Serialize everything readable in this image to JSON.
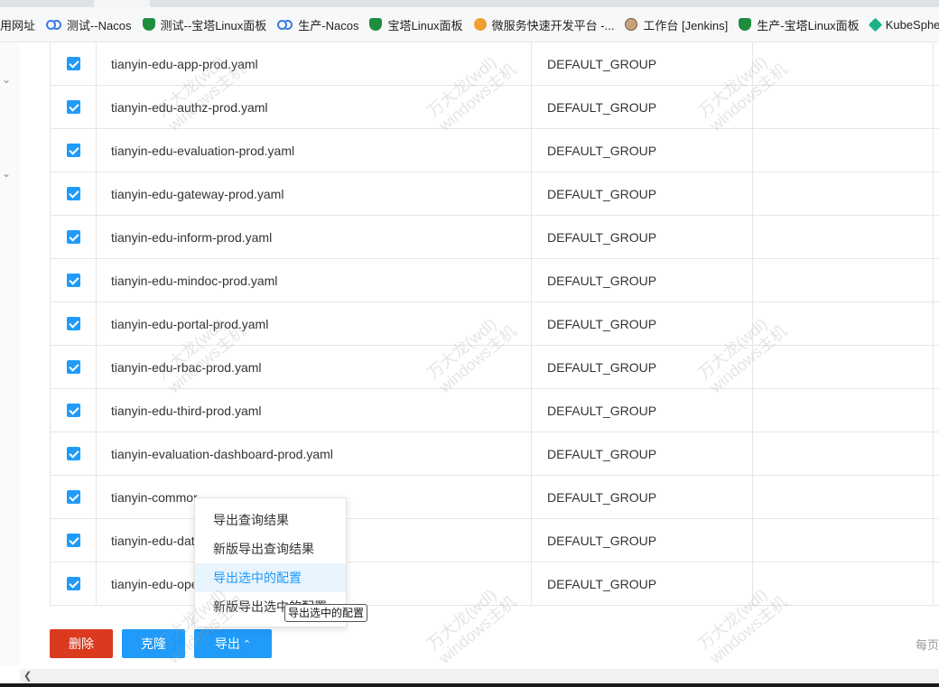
{
  "bookmarks": [
    {
      "label": "用网址",
      "icon": "none"
    },
    {
      "label": "测试--Nacos",
      "icon": "infinity-icon"
    },
    {
      "label": "测试--宝塔Linux面板",
      "icon": "shield-icon"
    },
    {
      "label": "生产-Nacos",
      "icon": "infinity-icon"
    },
    {
      "label": "宝塔Linux面板",
      "icon": "shield-icon"
    },
    {
      "label": "微服务快速开发平台 -...",
      "icon": "app-icon"
    },
    {
      "label": "工作台 [Jenkins]",
      "icon": "jenkins-icon"
    },
    {
      "label": "生产-宝塔Linux面板",
      "icon": "shield-icon"
    },
    {
      "label": "KubeSphere",
      "icon": "kubesphere-icon"
    }
  ],
  "rows": [
    {
      "data_id": "tianyin-edu-app-prod.yaml",
      "group": "DEFAULT_GROUP"
    },
    {
      "data_id": "tianyin-edu-authz-prod.yaml",
      "group": "DEFAULT_GROUP"
    },
    {
      "data_id": "tianyin-edu-evaluation-prod.yaml",
      "group": "DEFAULT_GROUP"
    },
    {
      "data_id": "tianyin-edu-gateway-prod.yaml",
      "group": "DEFAULT_GROUP"
    },
    {
      "data_id": "tianyin-edu-inform-prod.yaml",
      "group": "DEFAULT_GROUP"
    },
    {
      "data_id": "tianyin-edu-mindoc-prod.yaml",
      "group": "DEFAULT_GROUP"
    },
    {
      "data_id": "tianyin-edu-portal-prod.yaml",
      "group": "DEFAULT_GROUP"
    },
    {
      "data_id": "tianyin-edu-rbac-prod.yaml",
      "group": "DEFAULT_GROUP"
    },
    {
      "data_id": "tianyin-edu-third-prod.yaml",
      "group": "DEFAULT_GROUP"
    },
    {
      "data_id": "tianyin-evaluation-dashboard-prod.yaml",
      "group": "DEFAULT_GROUP"
    },
    {
      "data_id": "tianyin-commor",
      "group": "DEFAULT_GROUP"
    },
    {
      "data_id": "tianyin-edu-data",
      "group": "DEFAULT_GROUP"
    },
    {
      "data_id": "tianyin-edu-ope",
      "group": "DEFAULT_GROUP"
    }
  ],
  "buttons": {
    "delete": "删除",
    "clone": "克隆",
    "export": "导出",
    "export_caret": "⌃"
  },
  "export_menu": {
    "items": [
      "导出查询结果",
      "新版导出查询结果",
      "导出选中的配置",
      "新版导出选中的配置"
    ],
    "active_index": 2
  },
  "tooltip": "导出选中的配置",
  "pagination": {
    "prefix": "每页"
  },
  "watermark": {
    "line1": "万大龙(wdl)",
    "line2": "windows主机"
  },
  "colors": {
    "primary": "#209bfa",
    "danger": "#db3a1e"
  }
}
